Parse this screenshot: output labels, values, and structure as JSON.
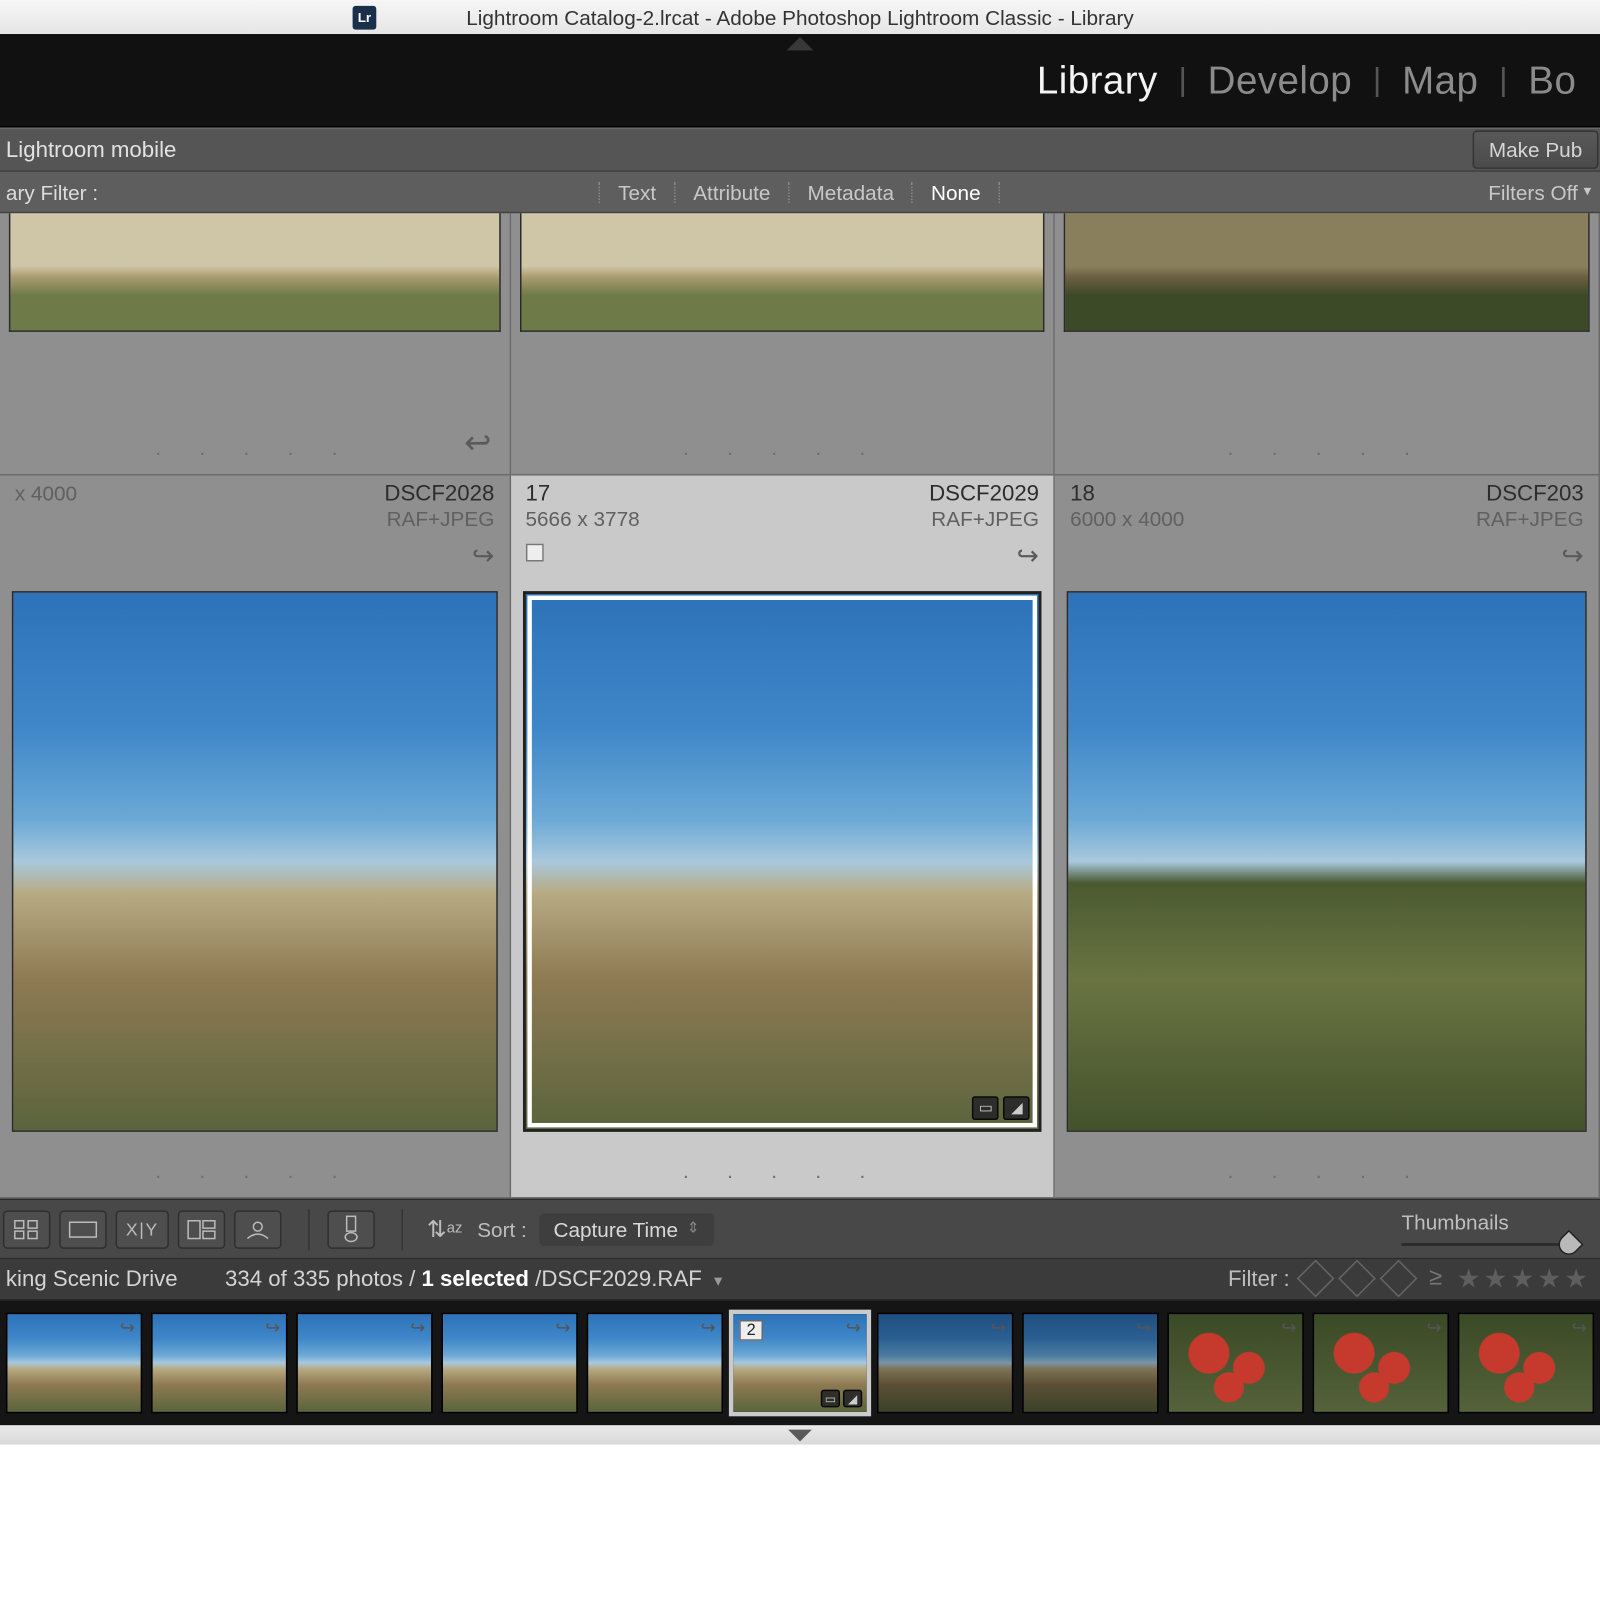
{
  "window": {
    "title": "Lightroom Catalog-2.lrcat - Adobe Photoshop Lightroom Classic - Library",
    "app_badge": "Lr"
  },
  "modules": {
    "library": "Library",
    "develop": "Develop",
    "map": "Map",
    "book": "Bo"
  },
  "sync": {
    "label": "Lightroom mobile",
    "make_public": "Make Pub"
  },
  "filter": {
    "label": "ary Filter :",
    "text": "Text",
    "attribute": "Attribute",
    "metadata": "Metadata",
    "none": "None",
    "filters_off": "Filters Off"
  },
  "grid": {
    "row1": [
      {
        "variant": "plain-top"
      },
      {
        "variant": "plain-top"
      },
      {
        "variant": "plain-top-d"
      }
    ],
    "row2": [
      {
        "index": "",
        "dimensions": "x 4000",
        "filename": "DSCF2028",
        "format": "RAF+JPEG",
        "selected": false,
        "variant": "sky-land"
      },
      {
        "index": "17",
        "dimensions": "5666 x 3778",
        "filename": "DSCF2029",
        "format": "RAF+JPEG",
        "selected": true,
        "variant": "sky-land"
      },
      {
        "index": "18",
        "dimensions": "6000 x 4000",
        "filename": "DSCF203",
        "format": "RAF+JPEG",
        "selected": false,
        "variant": "sky-land-trees"
      }
    ],
    "dots": ".  .  .  .  ."
  },
  "toolbar": {
    "sort_label": "Sort :",
    "sort_value": "Capture Time",
    "thumbs_label": "Thumbnails"
  },
  "status": {
    "folder": "king Scenic Drive",
    "count": "334 of 335 photos /",
    "selected": "1 selected",
    "file": " /DSCF2029.RAF",
    "filter_label": "Filter :"
  },
  "filmstrip": {
    "selected_index": 5,
    "selected_badge": "2",
    "items": [
      {
        "v": "sky-land"
      },
      {
        "v": "sky-land"
      },
      {
        "v": "sky-land"
      },
      {
        "v": "sky-land"
      },
      {
        "v": "sky-land"
      },
      {
        "v": "sky-land"
      },
      {
        "v": "sky-land-d"
      },
      {
        "v": "sky-land-d"
      },
      {
        "v": "flower"
      },
      {
        "v": "flower"
      },
      {
        "v": "flower"
      }
    ]
  }
}
